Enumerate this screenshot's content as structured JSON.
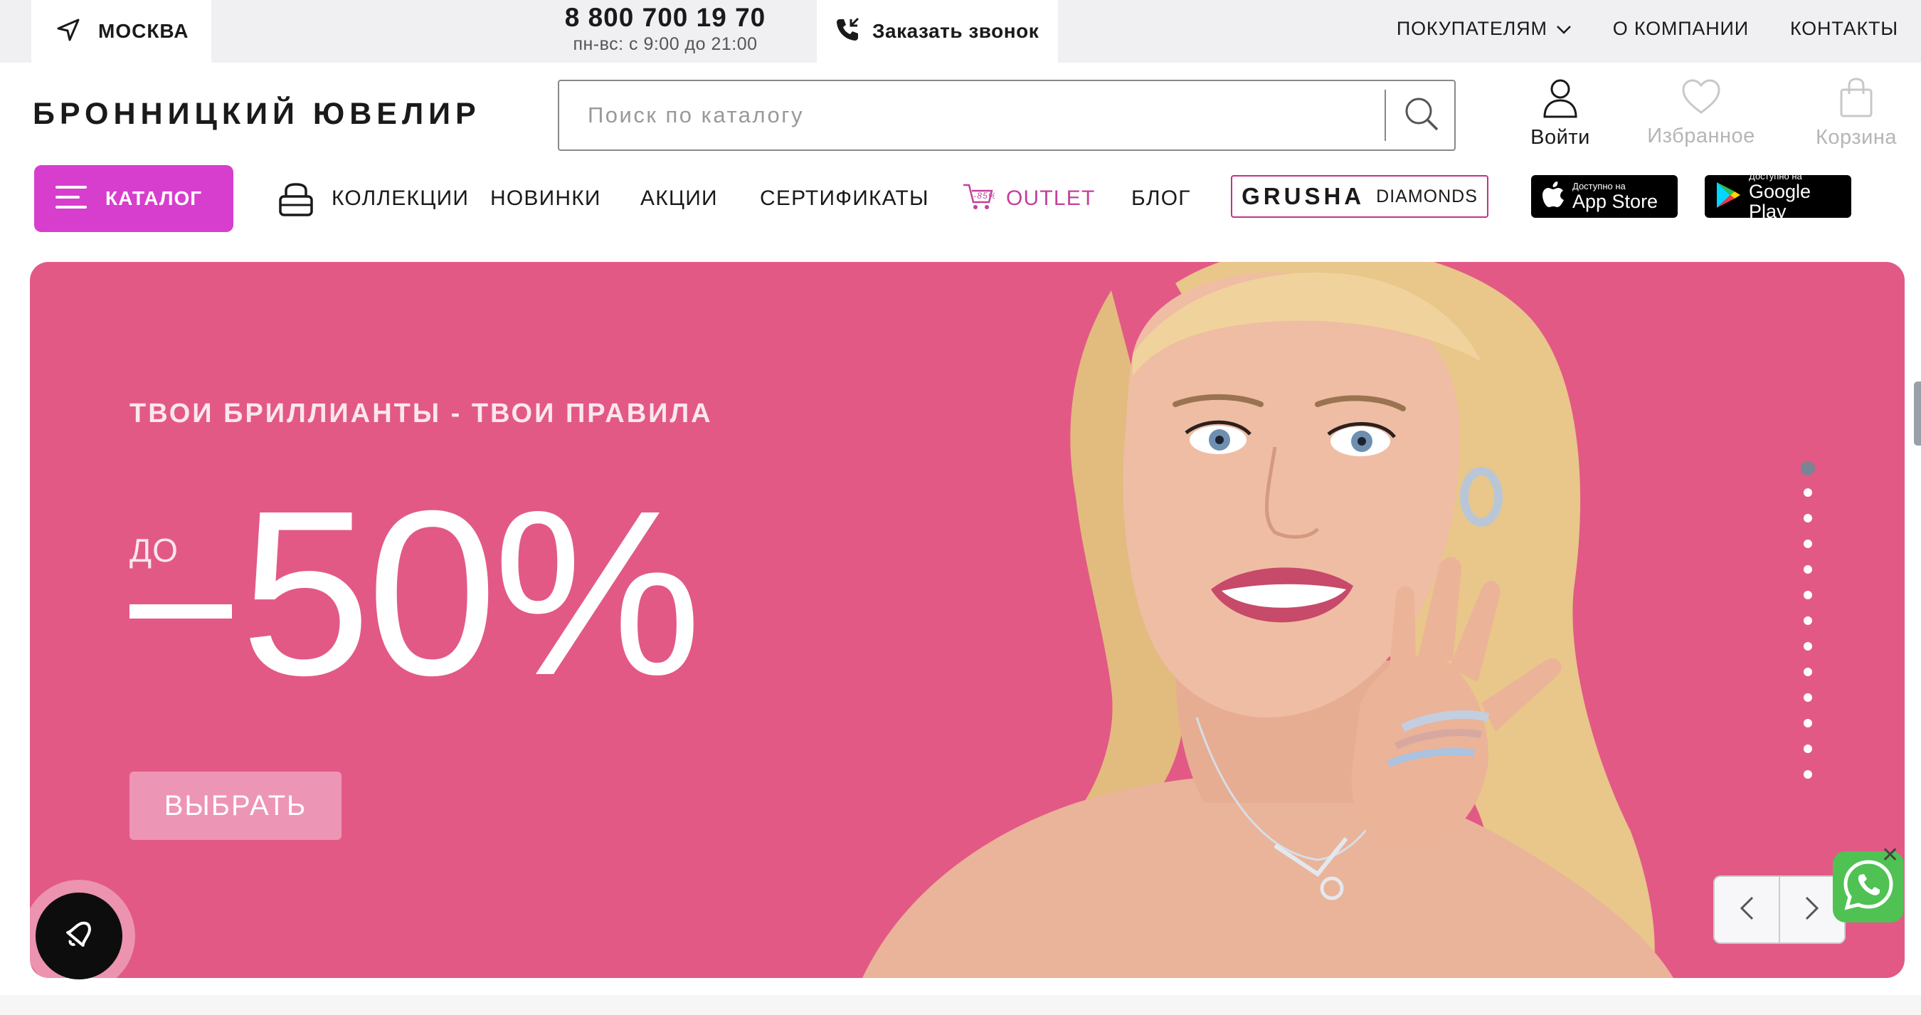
{
  "topbar": {
    "city": "МОСКВА",
    "phone": "8 800 700 19 70",
    "hours": "пн-вс: с 9:00 до 21:00",
    "callback": "Заказать звонок",
    "links": [
      "ПОКУПАТЕЛЯМ",
      "О КОМПАНИИ",
      "КОНТАКТЫ"
    ]
  },
  "header": {
    "logo": "БРОННИЦКИЙ ЮВЕЛИР",
    "search_placeholder": "Поиск по каталогу",
    "login": "Войти",
    "favorites": "Избранное",
    "cart": "Корзина"
  },
  "nav": {
    "catalog": "КАТАЛОГ",
    "items": [
      "КОЛЛЕКЦИИ",
      "НОВИНКИ",
      "АКЦИИ",
      "СЕРТИФИКАТЫ"
    ],
    "outlet_badge": "-85%",
    "outlet": "OUTLET",
    "blog": "БЛОГ",
    "grusha_brand": "GRUSHA",
    "grusha_sub": "DIAMONDS",
    "appstore_top": "Доступно на",
    "appstore": "App Store",
    "googleplay_top": "Доступно на",
    "googleplay": "Google Play"
  },
  "hero": {
    "tagline": "ТВОИ БРИЛЛИАНТЫ - ТВОИ ПРАВИЛА",
    "prefix": "ДО",
    "discount": "50%",
    "cta": "ВЫБРАТЬ",
    "slides_total": 13,
    "active_slide": 1
  },
  "colors": {
    "accent": "#d73ecd",
    "hero_bg": "#e25986",
    "outlet": "#c4419b",
    "whatsapp": "#4fc253"
  },
  "icons": [
    "location-arrow-icon",
    "phone-call-icon",
    "chevron-down-icon",
    "search-icon",
    "user-icon",
    "heart-icon",
    "bag-icon",
    "menu-icon",
    "ring-box-icon",
    "outlet-cart-icon",
    "apple-icon",
    "google-play-icon",
    "chevron-left-icon",
    "chevron-right-icon",
    "bell-icon",
    "whatsapp-icon",
    "close-icon"
  ]
}
